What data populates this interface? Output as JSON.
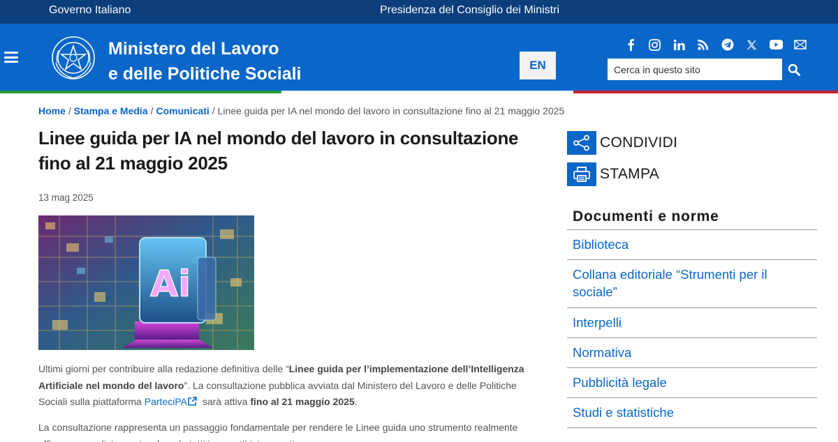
{
  "topbar": {
    "left": "Governo Italiano",
    "right": "Presidenza del Consiglio dei Ministri"
  },
  "header": {
    "brand_line1": "Ministero del Lavoro",
    "brand_line2": "e delle Politiche Sociali",
    "lang": "EN",
    "search_placeholder": "Cerca in questo sito",
    "socials": [
      "facebook-icon",
      "instagram-icon",
      "linkedin-icon",
      "rss-icon",
      "telegram-icon",
      "x-icon",
      "youtube-icon",
      "mail-icon"
    ]
  },
  "colors": {
    "topbar": "#0b3e7a",
    "header": "#0a66c8",
    "link": "#0a66c8",
    "flag_green": "#2a9a3a",
    "flag_red": "#c6262b"
  },
  "breadcrumb": {
    "home": "Home",
    "stampa": "Stampa e Media",
    "comunicati": "Comunicati",
    "current": "Linee guida per IA nel mondo del lavoro in consultazione fino al 21 maggio 2025"
  },
  "article": {
    "title": "Linee guida per IA nel mondo del lavoro in consultazione fino al 21 maggio 2025",
    "date": "13 mag 2025",
    "p1_a": "Ultimi giorni per contribuire alla redazione definitiva delle “",
    "p1_b": "Linee guida per l’implementazione dell’Intelligenza Artificiale nel mondo del lavoro",
    "p1_c": "”. La consultazione pubblica avviata dal Ministero del Lavoro e delle Politiche Sociali sulla piattaforma ",
    "p1_link": "ParteciPA",
    "p1_d": " sarà attiva ",
    "p1_e": "fino al 21 maggio 2025",
    "p1_f": ".",
    "p2": "La consultazione rappresenta un passaggio fondamentale per rendere le Linee guida uno strumento realmente efficace e condiviso, coinvolgendo tutti i soggetti interessati"
  },
  "sidebar": {
    "share": "CONDIVIDI",
    "print": "STAMPA",
    "docs_title": "Documenti e norme",
    "docs": [
      "Biblioteca",
      "Collana editoriale “Strumenti per il sociale”",
      "Interpelli",
      "Normativa",
      "Pubblicità legale",
      "Studi e statistiche"
    ]
  }
}
